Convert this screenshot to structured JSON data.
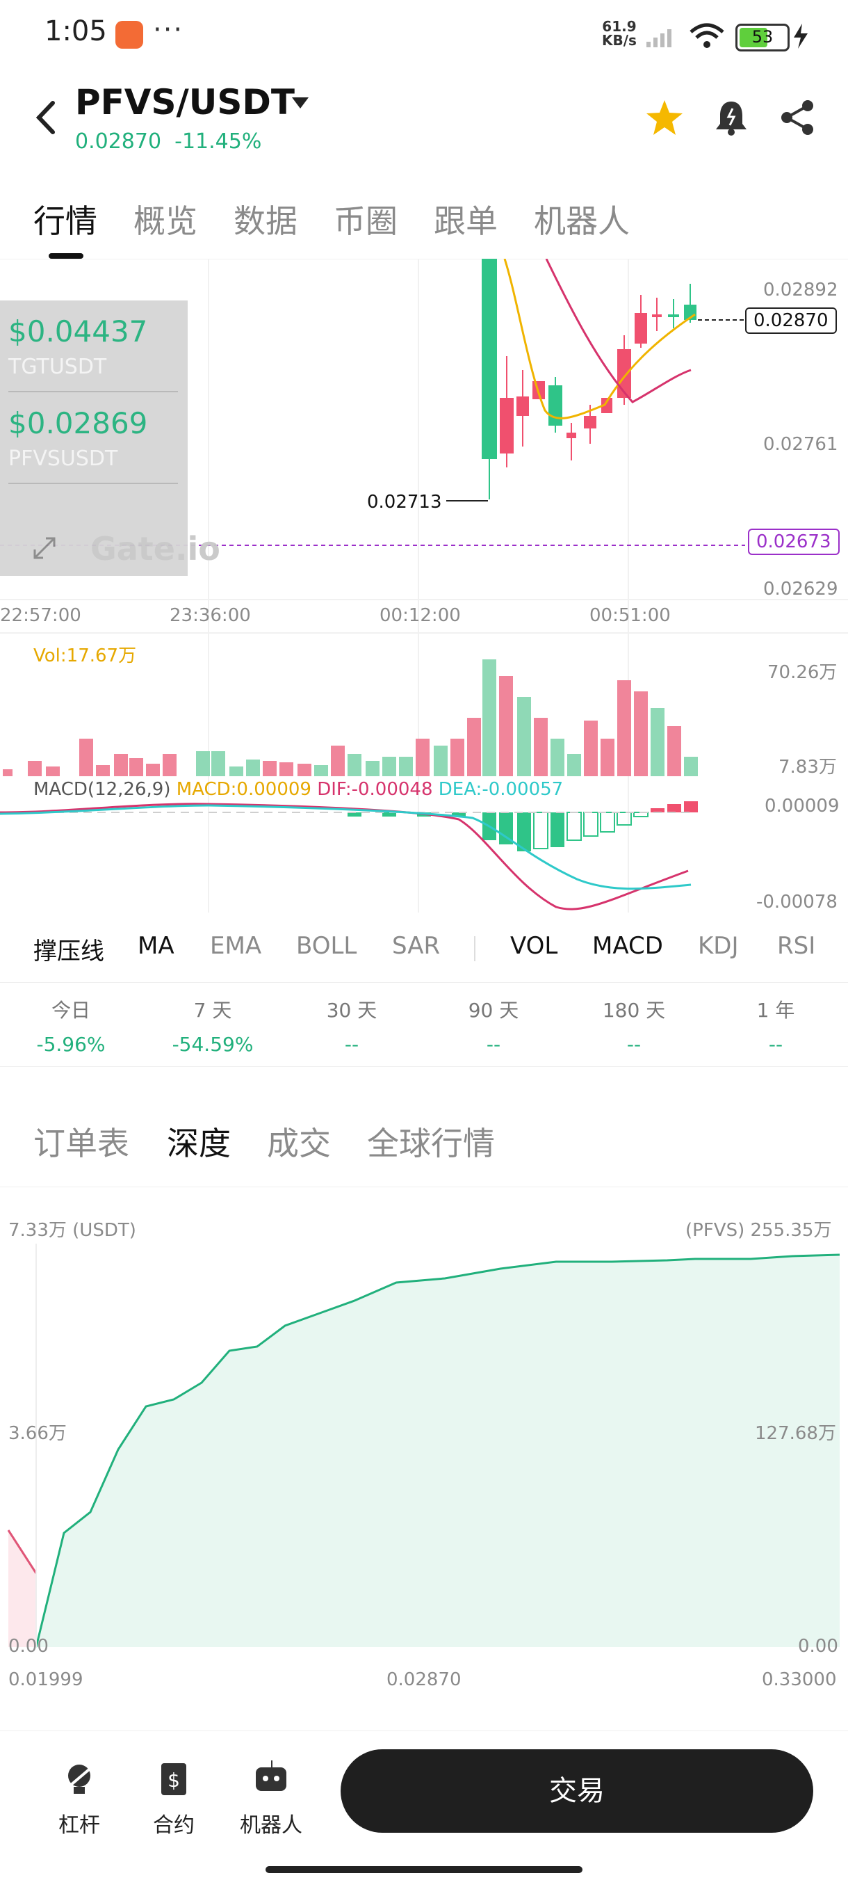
{
  "status": {
    "time": "1:05",
    "dots": "···",
    "net_speed_top": "61.9",
    "net_speed_unit": "KB/s",
    "battery": "53"
  },
  "header": {
    "pair": "PFVS/USDT",
    "last_price": "0.02870",
    "change_pct": "-11.45%"
  },
  "main_tabs": [
    "行情",
    "概览",
    "数据",
    "币圈",
    "跟单",
    "机器人"
  ],
  "kline": {
    "price_axis": [
      "0.02892",
      "0.02761",
      "0.02629"
    ],
    "current_price_tag": "0.02870",
    "marker_price_tag": "0.02673",
    "low_marker": "0.02713",
    "time_axis": [
      "22:57:00",
      "23:36:00",
      "00:12:00",
      "00:51:00"
    ],
    "overlay": [
      {
        "price": "$0.04437",
        "symbol": "TGTUSDT"
      },
      {
        "price": "$0.02869",
        "symbol": "PFVSUSDT"
      }
    ],
    "vol_label": "Vol:17.67万",
    "vol_axis": [
      "70.26万",
      "7.83万"
    ],
    "macd_label": "MACD(12,26,9)",
    "macd_value": "MACD:0.00009",
    "dif_value": "DIF:-0.00048",
    "dea_value": "DEA:-0.00057",
    "macd_axis": [
      "0.00009",
      "-0.00078"
    ],
    "watermark": "Gate.io",
    "colors": {
      "up": "#f0506e",
      "down": "#21b07c",
      "ma1": "#f0b400",
      "ma2": "#d6336c",
      "dea": "#2ec9c9",
      "marker": "#9b30c9"
    }
  },
  "indicators": [
    "撑压线",
    "MA",
    "EMA",
    "BOLL",
    "SAR",
    "VOL",
    "MACD",
    "KDJ",
    "RSI"
  ],
  "periods": [
    {
      "label": "今日",
      "value": "-5.96%"
    },
    {
      "label": "7 天",
      "value": "-54.59%"
    },
    {
      "label": "30 天",
      "value": "--"
    },
    {
      "label": "90 天",
      "value": "--"
    },
    {
      "label": "180 天",
      "value": "--"
    },
    {
      "label": "1 年",
      "value": "--"
    }
  ],
  "sub_tabs": [
    "订单表",
    "深度",
    "成交",
    "全球行情"
  ],
  "depth": {
    "y_left_top": "7.33万 (USDT)",
    "y_right_top": "(PFVS) 255.35万",
    "y_left_mid": "3.66万",
    "y_right_mid": "127.68万",
    "y_left_zero": "0.00",
    "y_right_zero": "0.00",
    "x_left": "0.01999",
    "x_mid": "0.02870",
    "x_right": "0.33000"
  },
  "bottom": {
    "items": [
      "杠杆",
      "合约",
      "机器人"
    ],
    "trade": "交易"
  }
}
